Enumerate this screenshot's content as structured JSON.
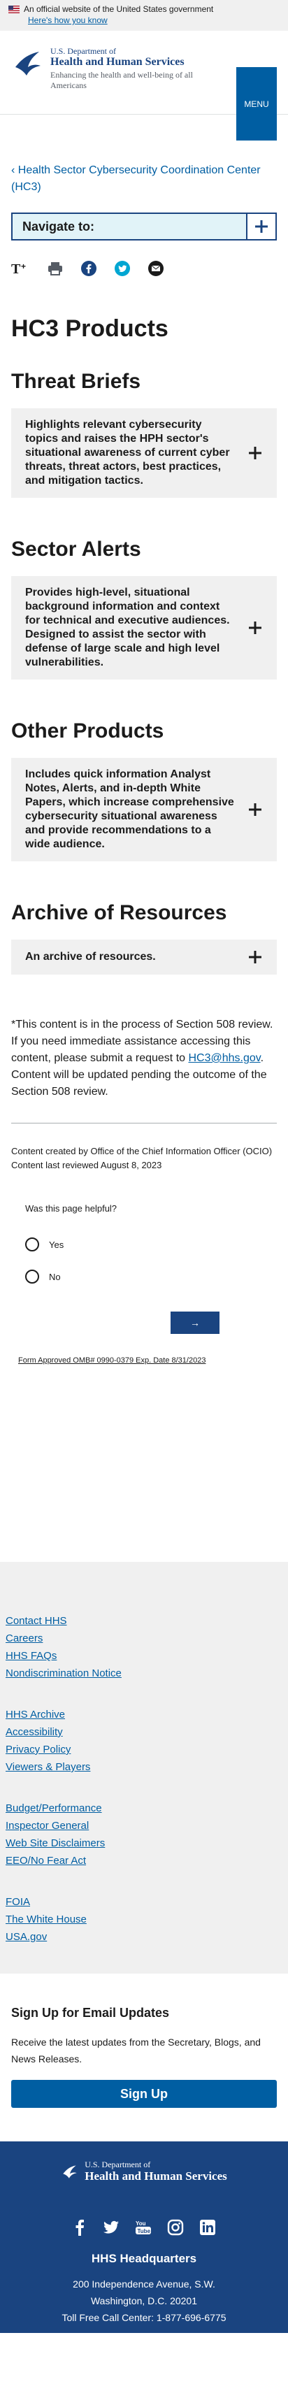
{
  "gov_banner": {
    "text": "An official website of the United States government",
    "link": "Here's how you know"
  },
  "header": {
    "dept": "U.S. Department of",
    "agency": "Health and Human Services",
    "tagline": "Enhancing the health and well-being of all Americans",
    "menu_label": "MENU"
  },
  "breadcrumb": "Health Sector Cybersecurity Coordination Center (HC3)",
  "sidenav": {
    "label": "Navigate to:"
  },
  "page_title": "HC3 Products",
  "sections": [
    {
      "heading": "Threat Briefs",
      "accordion": "Highlights relevant cybersecurity topics and raises the HPH sector's situational awareness of current cyber threats, threat actors, best practices, and mitigation tactics."
    },
    {
      "heading": "Sector Alerts",
      "accordion": "Provides high-level, situational background information and context for technical and executive audiences. Designed to assist the sector with defense of large scale and high level vulnerabilities."
    },
    {
      "heading": "Other Products",
      "accordion": "Includes quick information Analyst Notes, Alerts, and in-depth White Papers, which increase comprehensive cybersecurity situational awareness and provide recommendations to a wide audience."
    },
    {
      "heading": "Archive of Resources",
      "accordion": "An archive of resources."
    }
  ],
  "note": {
    "before": "*This content is in the process of Section 508 review. If you need immediate assistance accessing this content, please submit a request to ",
    "email": "HC3@hhs.gov",
    "after": ". Content will be updated pending the outcome of the Section 508 review."
  },
  "meta": {
    "created": "Content created by Office of the Chief Information Officer (OCIO)",
    "reviewed": "Content last reviewed August 8, 2023"
  },
  "feedback": {
    "question": "Was this page helpful?",
    "yes": "Yes",
    "no": "No",
    "submit": "→",
    "form_number": "Form Approved OMB# 0990-0379 Exp. Date 8/31/2023"
  },
  "footer": {
    "groups": [
      [
        "Contact HHS",
        "Careers",
        "HHS FAQs",
        "Nondiscrimination Notice"
      ],
      [
        "HHS Archive",
        "Accessibility",
        "Privacy Policy",
        "Viewers & Players"
      ],
      [
        "Budget/Performance",
        "Inspector General",
        "Web Site Disclaimers",
        "EEO/No Fear Act"
      ],
      [
        "FOIA",
        "The White House",
        "USA.gov"
      ]
    ]
  },
  "signup": {
    "title": "Sign Up for Email Updates",
    "text": "Receive the latest updates from the Secretary, Blogs, and News Releases.",
    "button": "Sign Up"
  },
  "bottom": {
    "dept": "U.S. Department of",
    "agency": "Health and Human Services",
    "social": [
      "facebook-icon",
      "twitter-icon",
      "youtube-icon",
      "instagram-icon",
      "linkedin-icon"
    ],
    "hq_title": "HHS Headquarters",
    "address1": "200 Independence Avenue, S.W.",
    "address2": "Washington, D.C. 20201",
    "phone": "Toll Free Call Center: 1-877-696-6775"
  },
  "colors": {
    "primary": "#005ea2",
    "dark": "#1a4480",
    "bg_gray": "#f0f0f0"
  }
}
